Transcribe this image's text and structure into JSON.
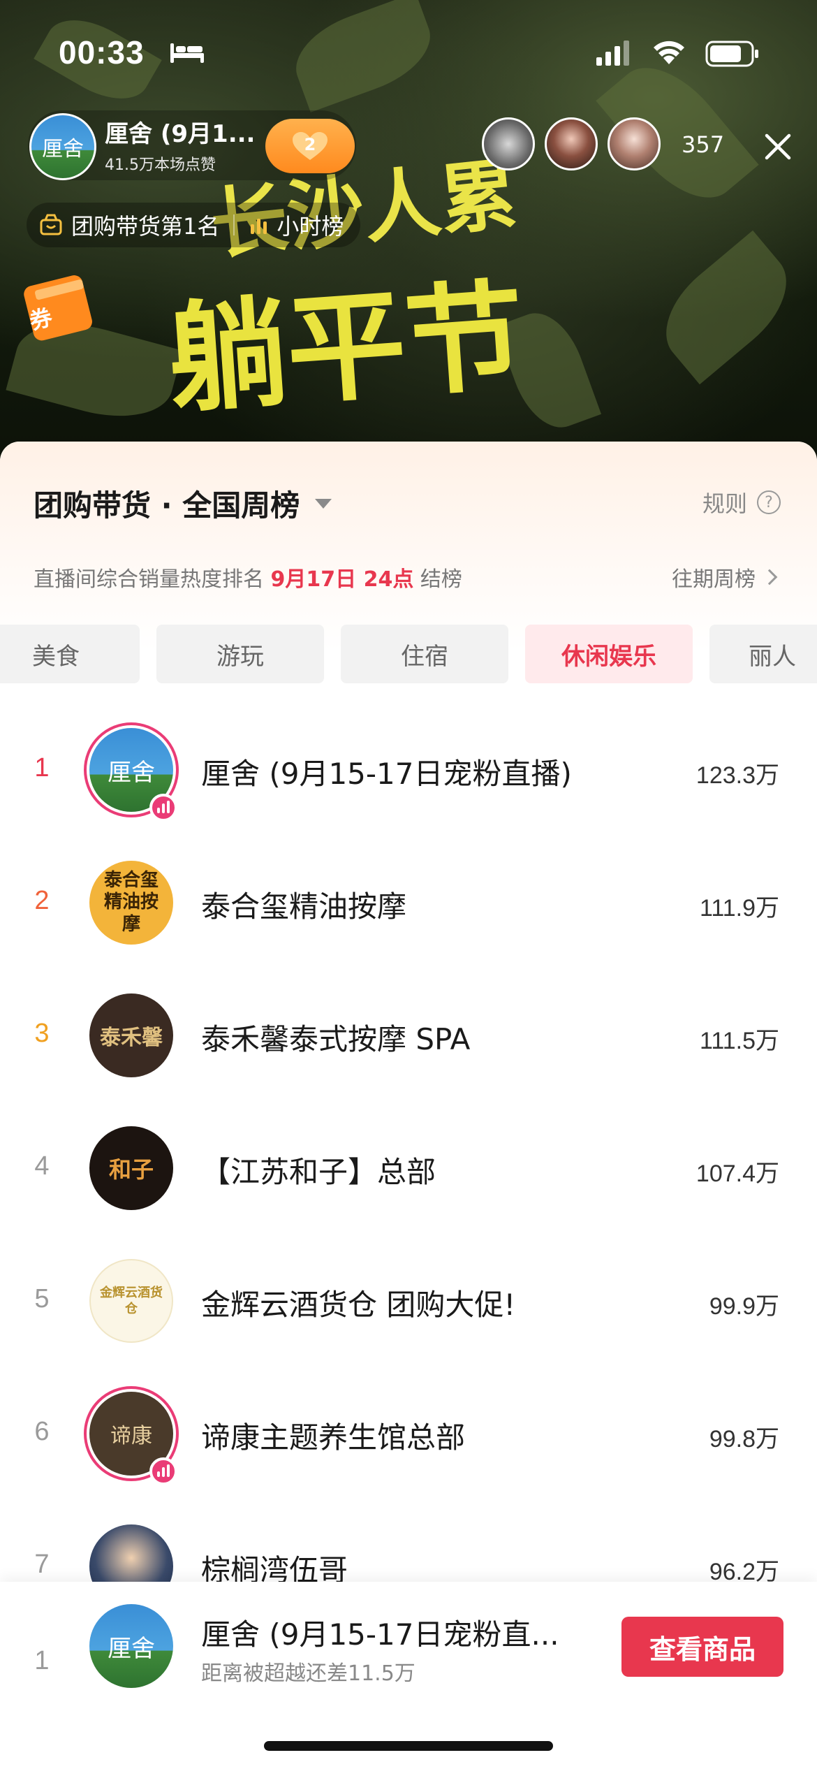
{
  "status_bar": {
    "time": "00:33"
  },
  "live_header": {
    "host_name": "厘舍 (9月1...",
    "host_avatar_text": "厘舍",
    "likes": "41.5万本场点赞",
    "follow_count": "2",
    "viewer_count": "357",
    "rank_chip_label": "团购带货第1名",
    "hourly_chip_label": "小时榜",
    "coupon_label": "券",
    "banner_line1": "长沙人累",
    "banner_line2": "躺平节"
  },
  "sheet": {
    "title": "团购带货 · 全国周榜",
    "rules_label": "规则",
    "subtitle_prefix": "直播间综合销量热度排名",
    "subtitle_date": "9月17日 24点",
    "subtitle_suffix": "结榜",
    "past_label": "往期周榜"
  },
  "tabs": [
    {
      "label": "美食",
      "active": false
    },
    {
      "label": "游玩",
      "active": false
    },
    {
      "label": "住宿",
      "active": false
    },
    {
      "label": "休闲娱乐",
      "active": true
    },
    {
      "label": "丽人",
      "active": false
    }
  ],
  "ranking": [
    {
      "rank": "1",
      "name": "厘舍 (9月15-17日宠粉直播)",
      "score": "123.3万",
      "avatar_text": "厘舍",
      "live": true
    },
    {
      "rank": "2",
      "name": "泰合玺精油按摩",
      "score": "111.9万",
      "avatar_text": "泰合玺精油按摩",
      "live": false
    },
    {
      "rank": "3",
      "name": "泰禾馨泰式按摩 SPA",
      "score": "111.5万",
      "avatar_text": "泰禾馨",
      "live": false
    },
    {
      "rank": "4",
      "name": "【江苏和子】总部",
      "score": "107.4万",
      "avatar_text": "和子",
      "live": false
    },
    {
      "rank": "5",
      "name": "金辉云酒货仓 团购大促!",
      "score": "99.9万",
      "avatar_text": "金辉云酒货仓",
      "live": false
    },
    {
      "rank": "6",
      "name": "谛康主题养生馆总部",
      "score": "99.8万",
      "avatar_text": "谛康",
      "live": true
    },
    {
      "rank": "7",
      "name": "棕榈湾伍哥",
      "score": "96.2万",
      "avatar_text": "",
      "live": false
    }
  ],
  "bottom": {
    "rank": "1",
    "name": "厘舍 (9月15-17日宠粉直...",
    "gap_text": "距离被超越还差11.5万",
    "avatar_text": "厘舍",
    "button_label": "查看商品"
  },
  "colors": {
    "accent_red": "#e8374e",
    "live_pink": "#ea3c76",
    "rank1": "#e8374e",
    "rank2": "#f0623a",
    "rank3": "#f0a020",
    "rank_other": "#9a9a9a"
  }
}
